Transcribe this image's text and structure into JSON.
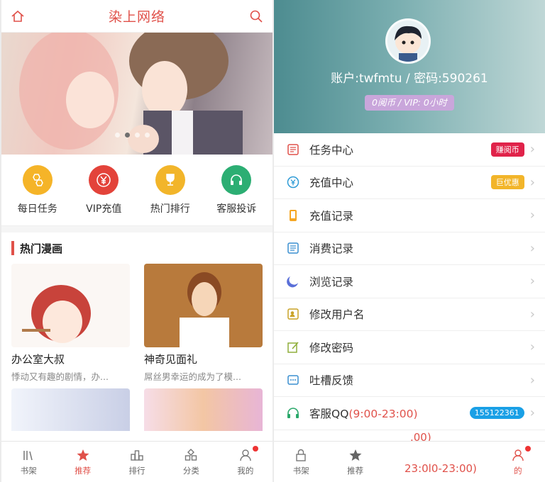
{
  "left": {
    "app_title": "染上网络",
    "quick": [
      {
        "label": "每日任务",
        "color": "#f5b428",
        "icon": "honeycomb-icon"
      },
      {
        "label": "VIP充值",
        "color": "#e3433a",
        "icon": "yen-icon"
      },
      {
        "label": "热门排行",
        "color": "#f2b52a",
        "icon": "trophy-icon"
      },
      {
        "label": "客服投诉",
        "color": "#2cae73",
        "icon": "headset-icon"
      }
    ],
    "section_title": "热门漫画",
    "comics": [
      {
        "title": "办公室大叔",
        "desc": "悸动又有趣的剧情，办..."
      },
      {
        "title": "神奇见面礼",
        "desc": "屌丝男幸运的成为了模..."
      }
    ],
    "tabs": [
      "书架",
      "推荐",
      "排行",
      "分类",
      "我的"
    ]
  },
  "right": {
    "account_line": "账户:twfmtu / 密码:590261",
    "balance": "0阅币 / VIP: 0小时",
    "menu": [
      {
        "label": "任务中心",
        "badge": "赚阅币",
        "badge_color": "#e0234a",
        "icon": "task-icon"
      },
      {
        "label": "充值中心",
        "badge": "巨优惠",
        "badge_color": "#f2b52a",
        "icon": "recharge-icon"
      },
      {
        "label": "充值记录",
        "icon": "phone-record-icon"
      },
      {
        "label": "消费记录",
        "icon": "receipt-icon"
      },
      {
        "label": "浏览记录",
        "icon": "history-icon"
      },
      {
        "label": "修改用户名",
        "icon": "user-edit-icon"
      },
      {
        "label": "修改密码",
        "icon": "pencil-icon"
      },
      {
        "label": "吐槽反馈",
        "icon": "feedback-icon"
      },
      {
        "label": "客服QQ",
        "hours": "(9:00-23:00)",
        "badge": "155122361",
        "badge_color": "#1aa0e6",
        "icon": "headset-icon"
      }
    ],
    "ghost_1": ".00)",
    "ghost_2": "23:0l0-23:00)",
    "tabs": [
      "书架",
      "推荐",
      "的"
    ]
  },
  "colors": {
    "accent": "#e0514a"
  }
}
